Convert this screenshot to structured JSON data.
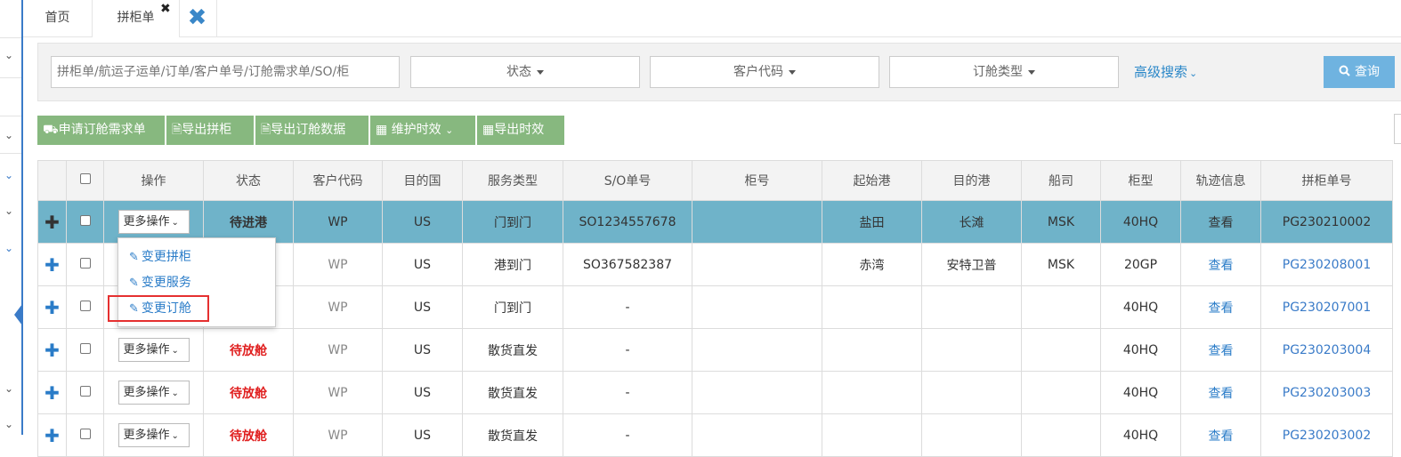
{
  "tabs": {
    "home": "首页",
    "active": "拼柜单",
    "active_close": "✖",
    "close_all": "✖"
  },
  "search": {
    "placeholder": "拼柜单/航运子运单/订单/客户单号/订舱需求单/SO/柜",
    "status_label": "状态",
    "customer_code_label": "客户代码",
    "booking_type_label": "订舱类型",
    "advanced_label": "高级搜索",
    "query_label": "查询"
  },
  "toolbar": {
    "apply_booking": "申请订舱需求单",
    "export_consolidation": "导出拼柜",
    "export_booking_data": "导出订舱数据",
    "maintain_timeliness": "维护时效",
    "export_timeliness": "导出时效"
  },
  "table": {
    "headers": [
      "操作",
      "状态",
      "客户代码",
      "目的国",
      "服务类型",
      "S/O单号",
      "柜号",
      "起始港",
      "目的港",
      "船司",
      "柜型",
      "轨迹信息",
      "拼柜单号"
    ],
    "more_ops_label": "更多操作",
    "rows": [
      {
        "status": "待进港",
        "customer": "WP",
        "country": "US",
        "service": "门到门",
        "so": "SO1234557678",
        "container": "",
        "origin": "盐田",
        "dest": "长滩",
        "carrier": "MSK",
        "ctype": "40HQ",
        "track": "查看",
        "pg": "PG230210002"
      },
      {
        "status": "",
        "customer": "WP",
        "country": "US",
        "service": "港到门",
        "so": "SO367582387",
        "container": "",
        "origin": "赤湾",
        "dest": "安特卫普",
        "carrier": "MSK",
        "ctype": "20GP",
        "track": "查看",
        "pg": "PG230208001"
      },
      {
        "status": "",
        "customer": "WP",
        "country": "US",
        "service": "门到门",
        "so": "-",
        "container": "",
        "origin": "",
        "dest": "",
        "carrier": "",
        "ctype": "40HQ",
        "track": "查看",
        "pg": "PG230207001"
      },
      {
        "status": "待放舱",
        "customer": "WP",
        "country": "US",
        "service": "散货直发",
        "so": "-",
        "container": "",
        "origin": "",
        "dest": "",
        "carrier": "",
        "ctype": "40HQ",
        "track": "查看",
        "pg": "PG230203004"
      },
      {
        "status": "待放舱",
        "customer": "WP",
        "country": "US",
        "service": "散货直发",
        "so": "-",
        "container": "",
        "origin": "",
        "dest": "",
        "carrier": "",
        "ctype": "40HQ",
        "track": "查看",
        "pg": "PG230203003"
      },
      {
        "status": "待放舱",
        "customer": "WP",
        "country": "US",
        "service": "散货直发",
        "so": "-",
        "container": "",
        "origin": "",
        "dest": "",
        "carrier": "",
        "ctype": "40HQ",
        "track": "查看",
        "pg": "PG230203002"
      }
    ]
  },
  "menu": {
    "items": [
      "变更拼柜",
      "变更服务",
      "变更订舱"
    ]
  },
  "colors": {
    "accent": "#2a7cc8",
    "toolbar_green": "#87b87f",
    "selected_row": "#6fb3c9",
    "status_red": "#e02020",
    "highlight_box": "#e53030"
  },
  "icons": {
    "toolbar_1": "truck-icon",
    "toolbar_2": "file-excel-icon",
    "toolbar_3": "file-excel-icon",
    "toolbar_4": "calendar-icon",
    "toolbar_5": "calendar-icon",
    "query": "search-icon",
    "menu": "edit-icon",
    "row_expand": "plus-icon"
  }
}
